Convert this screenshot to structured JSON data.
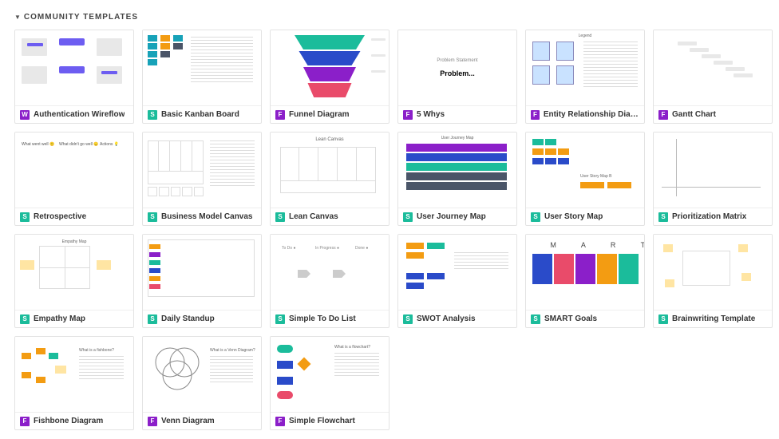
{
  "section": {
    "title": "COMMUNITY TEMPLATES"
  },
  "badges": {
    "w": "W",
    "s": "S",
    "f": "F"
  },
  "templates": [
    {
      "name": "Authentication Wireflow",
      "badge": "w",
      "color": "purple"
    },
    {
      "name": "Basic Kanban Board",
      "badge": "s",
      "color": "teal"
    },
    {
      "name": "Funnel Diagram",
      "badge": "f",
      "color": "purple"
    },
    {
      "name": "5 Whys",
      "badge": "f",
      "color": "purple"
    },
    {
      "name": "Entity Relationship Diagram",
      "badge": "f",
      "color": "purple"
    },
    {
      "name": "Gantt Chart",
      "badge": "f",
      "color": "purple"
    },
    {
      "name": "Retrospective",
      "badge": "s",
      "color": "teal"
    },
    {
      "name": "Business Model Canvas",
      "badge": "s",
      "color": "teal"
    },
    {
      "name": "Lean Canvas",
      "badge": "s",
      "color": "teal"
    },
    {
      "name": "User Journey Map",
      "badge": "s",
      "color": "teal"
    },
    {
      "name": "User Story Map",
      "badge": "s",
      "color": "teal"
    },
    {
      "name": "Prioritization Matrix",
      "badge": "s",
      "color": "teal"
    },
    {
      "name": "Empathy Map",
      "badge": "s",
      "color": "teal"
    },
    {
      "name": "Daily Standup",
      "badge": "s",
      "color": "teal"
    },
    {
      "name": "Simple To Do List",
      "badge": "s",
      "color": "teal"
    },
    {
      "name": "SWOT Analysis",
      "badge": "s",
      "color": "teal"
    },
    {
      "name": "SMART Goals",
      "badge": "s",
      "color": "teal"
    },
    {
      "name": "Brainwriting Template",
      "badge": "s",
      "color": "teal"
    },
    {
      "name": "Fishbone Diagram",
      "badge": "f",
      "color": "purple"
    },
    {
      "name": "Venn Diagram",
      "badge": "f",
      "color": "purple"
    },
    {
      "name": "Simple Flowchart",
      "badge": "f",
      "color": "purple"
    }
  ],
  "thumbs": {
    "whys_label": "Problem Statement",
    "whys_text": "Problem...",
    "lean_title": "Lean Canvas",
    "journey_title": "User Journey Map",
    "story_title": "User Story Map B",
    "smart_letters": "S   M   A   R   T",
    "empathy_title": "Empathy Map",
    "retro_c1": "What went well 🙂",
    "retro_c2": "What didn't go well 😞",
    "retro_c3": "Actions 💡",
    "todo_c1": "To Do ●",
    "todo_c2": "In Progress ●",
    "todo_c3": "Done ●",
    "venn_title": "What is a Venn Diagram?",
    "fishbone_title": "What is a fishbone?",
    "flowchart_title": "What is a flowchart?",
    "legend_title": "Legend"
  }
}
